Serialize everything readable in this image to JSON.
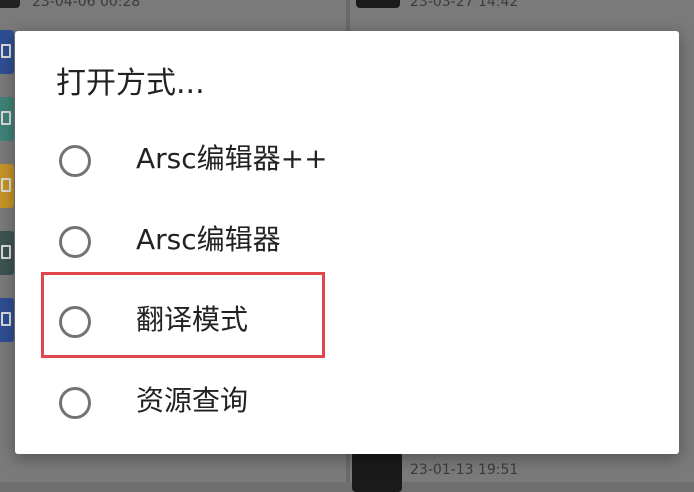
{
  "background": {
    "timestamps": [
      "23-04-06 00:28",
      "23-03-27 14:42",
      "23-01-13 19:51"
    ],
    "file_icon_colors": [
      "#2e4e93",
      "#3e8277",
      "#c59327",
      "#3e5252",
      "#2e4e93"
    ]
  },
  "dialog": {
    "title": "打开方式...",
    "options": [
      {
        "label": "Arsc编辑器++",
        "selected": false
      },
      {
        "label": "Arsc编辑器",
        "selected": false
      },
      {
        "label": "翻译模式",
        "selected": false,
        "highlighted": true
      },
      {
        "label": "资源查询",
        "selected": false
      }
    ],
    "highlight_color": "#e0474c"
  }
}
